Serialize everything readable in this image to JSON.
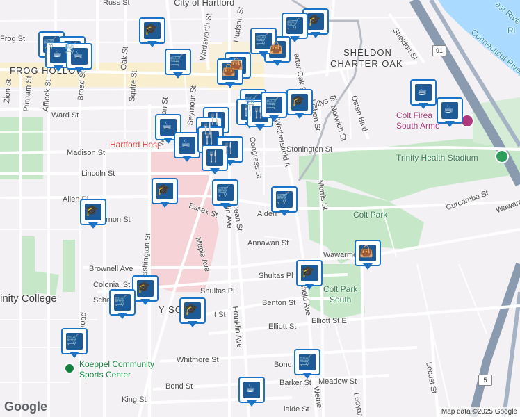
{
  "map": {
    "areas": {
      "city_of_hartford": "City of Hartford",
      "frog_hollow": "FROG HOLLOW",
      "sheldon": "SHELDON",
      "charter_oak": "CHARTER OAK",
      "y_square": "Y SQUAR"
    },
    "places": {
      "hartford_hospital": "Hartford Hosp",
      "trinity_health_stadium": "Trinity Health Stadium",
      "colt_park": "Colt Park",
      "colt_park_south_1": "Colt Park",
      "colt_park_south_2": "South",
      "colt_fire_1": "Colt Firea",
      "colt_fire_2": "South Armo",
      "koeppel_1": "Koeppel Community",
      "koeppel_2": "Sports Center",
      "trinity_college": "inity College",
      "connecticut_river": "Connecticut River",
      "river_top": "Ri",
      "river_top2": "ast Rive"
    },
    "streets": {
      "russ": "Russ St",
      "hudson": "Hudson St",
      "wadsworth": "Wadsworth St",
      "oak": "Oak St",
      "broad_top": "Broad St",
      "putnam": "Putnam St",
      "affleck": "Affleck St",
      "squire": "Squire St",
      "ward": "Ward St",
      "madison": "Madison St",
      "lincoln": "Lincoln St",
      "allen": "Allen Pl",
      "vernon": "ernon St",
      "essex": "Essex St",
      "washington_top": "Washington St",
      "seymour": "Seymour St",
      "washington_bot": "ashington St",
      "congress": "Congress St",
      "stonington": "Stonington St",
      "wethersfield_top": "Wethersfield A",
      "wyllys": "Wyllys St",
      "norwich": "Norwich St",
      "osten": "Osten Blvd",
      "lisbon": "Lisbon St",
      "charter_oak_pl": "arter Oak P",
      "sheldon_st": "Sheldon St",
      "morris": "Morris St",
      "curcombe": "Curcombe St",
      "wawarme_r": "Wawarme",
      "wawarme_mid": "Wawarme Ave",
      "alden": "Alden",
      "dean": "Dean St",
      "franklin_top": "Franklin Ave",
      "franklin_mid": "Franklin Ave",
      "maple": "Maple Ave",
      "annawan": "Annawan St",
      "brownell": "Brownell Ave",
      "colonial": "Colonial St",
      "shultas_l": "Shultas Pl",
      "shultas_r": "Shultas Pl",
      "benton": "Benton St",
      "elliott_l": "Elliott St",
      "elliott_r": "Elliott St E",
      "wethersfield_bot": "thersfield Ave",
      "wethersfield_bot2": "Wethe",
      "whitmore": "Whitmore St",
      "bond_l": "Bond St",
      "bond_r": "Bond S",
      "barker": "Barker St",
      "meadow": "Meadow St",
      "king": "King St",
      "adelaide": "laide St",
      "locust": "Locust St",
      "ledyard": "Ledyar",
      "zion": "Zion St",
      "frog_st": "Frog St",
      "broad_low": "Broad",
      "sche": "Sche",
      "st_e": "t St",
      "pl_label": "Pl",
      "wethersfield_label": "Wethersfield A",
      "rich": "Ri",
      "s_label": "St",
      "ct_label": "ct",
      "cou": "m St"
    },
    "highway": {
      "i91_a": "91",
      "i91_b": "91",
      "us5": "5"
    },
    "icons": [
      {
        "type": "cap"
      },
      {
        "type": "cart"
      },
      {
        "type": "cart"
      },
      {
        "type": "cap"
      },
      {
        "type": "cart"
      },
      {
        "type": "coffee"
      },
      {
        "type": "coffee"
      },
      {
        "type": "cart"
      },
      {
        "type": "bag"
      },
      {
        "type": "bag"
      },
      {
        "type": "bag"
      },
      {
        "type": "cart"
      },
      {
        "type": "cart"
      },
      {
        "type": "fork"
      },
      {
        "type": "fork"
      },
      {
        "type": "cart"
      },
      {
        "type": "cap"
      },
      {
        "type": "coffee"
      },
      {
        "type": "fork"
      },
      {
        "type": "fork"
      },
      {
        "type": "coffee"
      },
      {
        "type": "fork"
      },
      {
        "type": "fork"
      },
      {
        "type": "fork"
      },
      {
        "type": "cap"
      },
      {
        "type": "cart"
      },
      {
        "type": "cap"
      },
      {
        "type": "cart"
      },
      {
        "type": "bag"
      },
      {
        "type": "cap"
      },
      {
        "type": "cap"
      },
      {
        "type": "cart"
      },
      {
        "type": "cap"
      },
      {
        "type": "cart"
      },
      {
        "type": "cart"
      },
      {
        "type": "coffee"
      },
      {
        "type": "coffee"
      },
      {
        "type": "coffee"
      },
      {
        "type": "cart"
      }
    ],
    "glyphs": {
      "cap": "🎓",
      "cart": "🛒",
      "coffee": "☕",
      "fork": "🍴",
      "bag": "👜"
    }
  },
  "footer": {
    "google_logo": "Google",
    "attribution": "Map data ©2025 Google"
  }
}
